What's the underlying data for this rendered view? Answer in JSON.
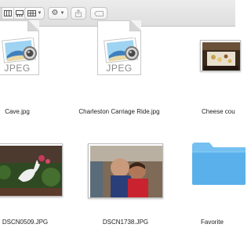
{
  "toolbar": {
    "view_icons": [
      "icon-view-icon",
      "list-view-icon",
      "column-view-icon",
      "gallery-view-icon"
    ],
    "arrange_icon": "grid-arrange-icon",
    "action_icon": "gear-icon",
    "share_icon": "share-icon",
    "tag_icon": "tag-icon"
  },
  "files": [
    {
      "name": "Cave.jpg",
      "kind": "jpeg-document",
      "icon_label": "JPEG"
    },
    {
      "name": "Charleston Carriage Ride.jpg",
      "kind": "jpeg-document",
      "icon_label": "JPEG"
    },
    {
      "name": "Cheese cou",
      "kind": "photo-thumbnail"
    },
    {
      "name": "DSCN0509.JPG",
      "kind": "photo-thumbnail"
    },
    {
      "name": "DSCN1738.JPG",
      "kind": "photo-thumbnail"
    },
    {
      "name": "Favorite",
      "kind": "folder"
    }
  ],
  "colors": {
    "folder": "#5ab0ea",
    "folder_tab": "#74c0f0",
    "label_text": "#222222",
    "toolbar_bg": "#e4e4e4"
  }
}
